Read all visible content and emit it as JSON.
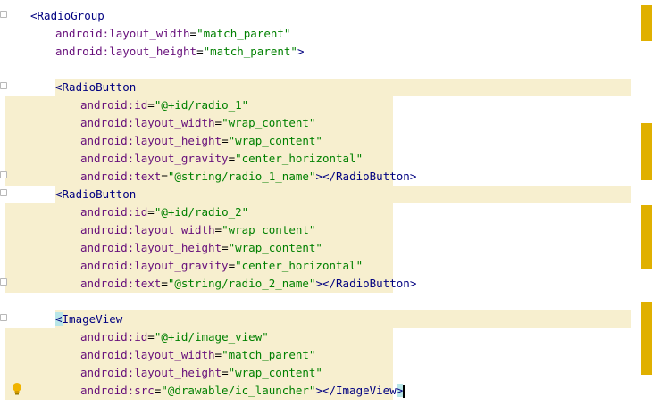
{
  "editor": {
    "language": "xml",
    "lines": [
      {
        "parts": [
          [
            "punc",
            "<"
          ],
          [
            "tag",
            "RadioGroup"
          ]
        ]
      },
      {
        "parts": [
          [
            "attr-ns",
            "android:"
          ],
          [
            "attr",
            "layout_width"
          ],
          [
            "eq",
            "="
          ],
          [
            "val",
            "\"match_parent\""
          ]
        ]
      },
      {
        "parts": [
          [
            "attr-ns",
            "android:"
          ],
          [
            "attr",
            "layout_height"
          ],
          [
            "eq",
            "="
          ],
          [
            "val",
            "\"match_parent\""
          ],
          [
            "punc",
            ">"
          ]
        ]
      },
      {
        "parts": []
      },
      {
        "parts": [
          [
            "punc",
            "<"
          ],
          [
            "tag",
            "RadioButton"
          ]
        ]
      },
      {
        "parts": [
          [
            "attr-ns",
            "android:"
          ],
          [
            "attr",
            "id"
          ],
          [
            "eq",
            "="
          ],
          [
            "val",
            "\"@+id/radio_1\""
          ]
        ]
      },
      {
        "parts": [
          [
            "attr-ns",
            "android:"
          ],
          [
            "attr",
            "layout_width"
          ],
          [
            "eq",
            "="
          ],
          [
            "val",
            "\"wrap_content\""
          ]
        ]
      },
      {
        "parts": [
          [
            "attr-ns",
            "android:"
          ],
          [
            "attr",
            "layout_height"
          ],
          [
            "eq",
            "="
          ],
          [
            "val",
            "\"wrap_content\""
          ]
        ]
      },
      {
        "parts": [
          [
            "attr-ns",
            "android:"
          ],
          [
            "attr",
            "layout_gravity"
          ],
          [
            "eq",
            "="
          ],
          [
            "val",
            "\"center_horizontal\""
          ]
        ]
      },
      {
        "parts": [
          [
            "attr-ns",
            "android:"
          ],
          [
            "attr",
            "text"
          ],
          [
            "eq",
            "="
          ],
          [
            "val",
            "\"@string/radio_1_name\""
          ],
          [
            "punc",
            "></"
          ],
          [
            "tag",
            "RadioButton"
          ],
          [
            "punc",
            ">"
          ]
        ]
      },
      {
        "parts": [
          [
            "punc",
            "<"
          ],
          [
            "tag",
            "RadioButton"
          ]
        ]
      },
      {
        "parts": [
          [
            "attr-ns",
            "android:"
          ],
          [
            "attr",
            "id"
          ],
          [
            "eq",
            "="
          ],
          [
            "val",
            "\"@+id/radio_2\""
          ]
        ]
      },
      {
        "parts": [
          [
            "attr-ns",
            "android:"
          ],
          [
            "attr",
            "layout_width"
          ],
          [
            "eq",
            "="
          ],
          [
            "val",
            "\"wrap_content\""
          ]
        ]
      },
      {
        "parts": [
          [
            "attr-ns",
            "android:"
          ],
          [
            "attr",
            "layout_height"
          ],
          [
            "eq",
            "="
          ],
          [
            "val",
            "\"wrap_content\""
          ]
        ]
      },
      {
        "parts": [
          [
            "attr-ns",
            "android:"
          ],
          [
            "attr",
            "layout_gravity"
          ],
          [
            "eq",
            "="
          ],
          [
            "val",
            "\"center_horizontal\""
          ]
        ]
      },
      {
        "parts": [
          [
            "attr-ns",
            "android:"
          ],
          [
            "attr",
            "text"
          ],
          [
            "eq",
            "="
          ],
          [
            "val",
            "\"@string/radio_2_name\""
          ],
          [
            "punc",
            "></"
          ],
          [
            "tag",
            "RadioButton"
          ],
          [
            "punc",
            ">"
          ]
        ]
      },
      {
        "parts": []
      },
      {
        "parts": [
          [
            "tag-hl",
            "<"
          ],
          [
            "tag",
            "ImageView"
          ]
        ]
      },
      {
        "parts": [
          [
            "attr-ns",
            "android:"
          ],
          [
            "attr",
            "id"
          ],
          [
            "eq",
            "="
          ],
          [
            "val",
            "\"@+id/image_view\""
          ]
        ]
      },
      {
        "parts": [
          [
            "attr-ns",
            "android:"
          ],
          [
            "attr",
            "layout_width"
          ],
          [
            "eq",
            "="
          ],
          [
            "val",
            "\"match_parent\""
          ]
        ]
      },
      {
        "parts": [
          [
            "attr-ns",
            "android:"
          ],
          [
            "attr",
            "layout_height"
          ],
          [
            "eq",
            "="
          ],
          [
            "val",
            "\"wrap_content\""
          ]
        ]
      },
      {
        "parts": [
          [
            "attr-ns",
            "android:"
          ],
          [
            "attr",
            "src"
          ],
          [
            "eq",
            "="
          ],
          [
            "val",
            "\"@drawable/ic_launcher\""
          ],
          [
            "punc",
            "></"
          ],
          [
            "tag",
            "ImageView"
          ],
          [
            "tag-hl",
            ">"
          ]
        ]
      }
    ]
  },
  "colors": {
    "highlight_band": "#f7efcf",
    "scroll_marker": "#e0b000",
    "tag": "#000080",
    "attribute": "#660e7a",
    "value": "#008000"
  },
  "icons": {
    "intention": "lightbulb-icon",
    "fold": "fold-marker-icon"
  }
}
